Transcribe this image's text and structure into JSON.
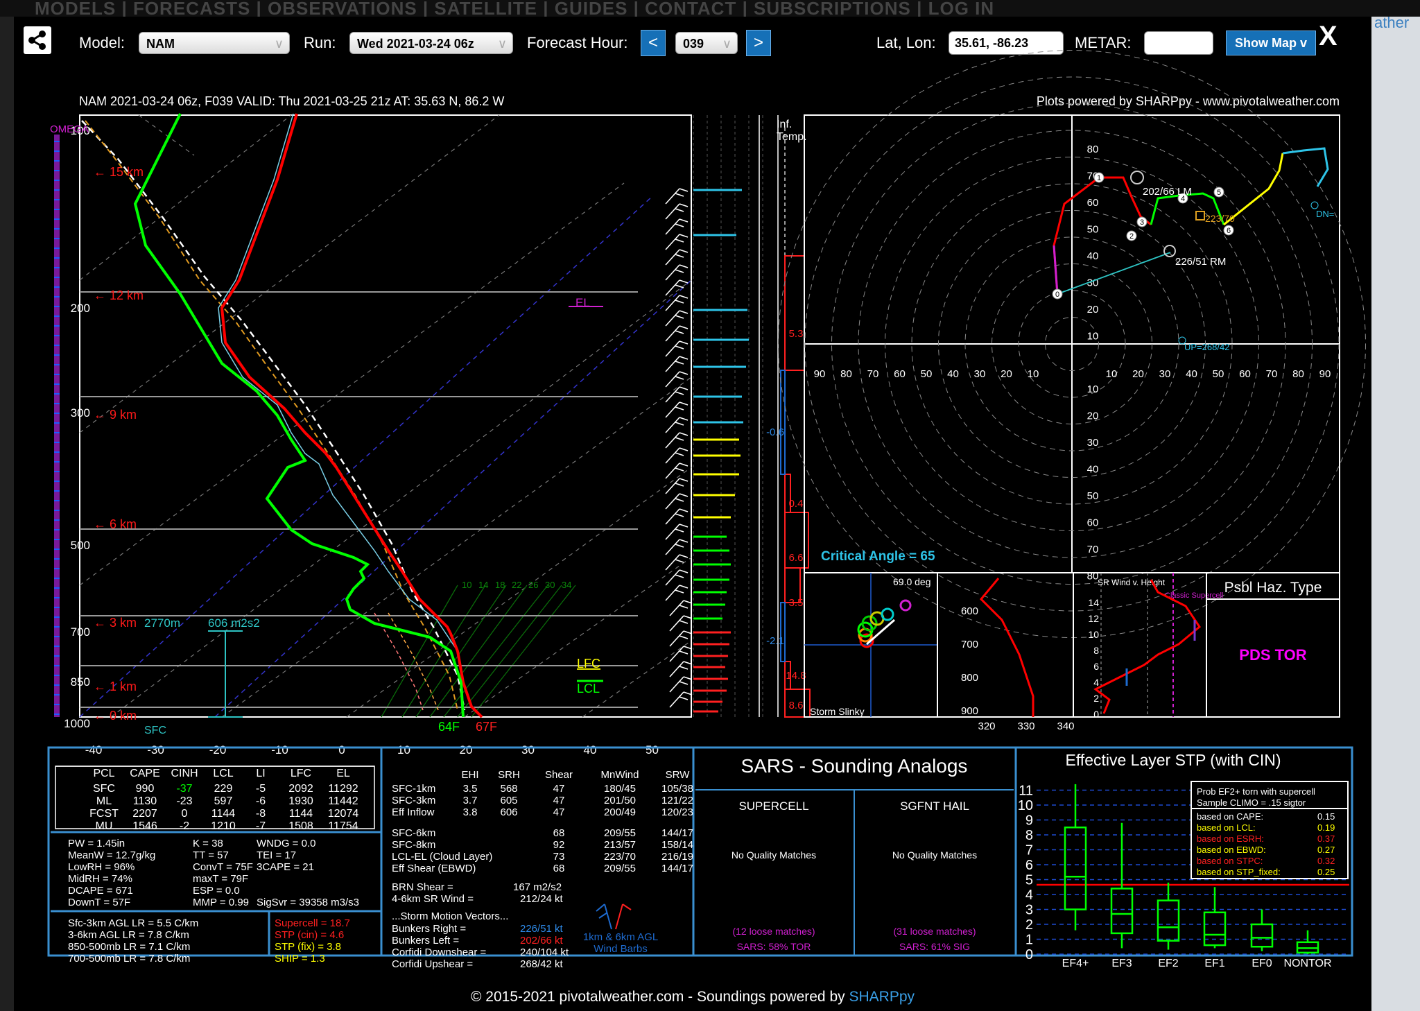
{
  "background": {
    "nav_text": "MODELS | FORECASTS | OBSERVATIONS | SATELLITE | GUIDES | CONTACT | SUBSCRIPTIONS | LOG IN",
    "right_word": "ather"
  },
  "toolbar": {
    "model_label": "Model:",
    "model_value": "NAM",
    "run_label": "Run:",
    "run_value": "Wed 2021-03-24 06z",
    "fhour_label": "Forecast Hour:",
    "fhour_prev": "<",
    "fhour_value": "039",
    "fhour_next": ">",
    "latlon_label": "Lat, Lon:",
    "latlon_value": "35.61, -86.23",
    "metar_label": "METAR:",
    "metar_value": "",
    "show_map": "Show Map v",
    "close": "X"
  },
  "header": {
    "left": "NAM 2021-03-24 06z, F039  VALID: Thu 2021-03-25 21z  AT: 35.63 N, 86.2 W",
    "right": "Plots powered by SHARPpy - www.pivotalweather.com"
  },
  "skewt": {
    "pressure_labels": [
      "100",
      "200",
      "300",
      "500",
      "700",
      "850",
      "1000"
    ],
    "height_labels": [
      "15 km",
      "12 km",
      "9 km",
      "6 km",
      "3 km",
      "1 km",
      "0 km"
    ],
    "temp_ticks": [
      "-40",
      "-30",
      "-20",
      "-10",
      "0",
      "10",
      "20",
      "30",
      "40",
      "50"
    ],
    "omega": "OMEGA",
    "el": "EL",
    "lfc": "LFC",
    "lcl": "LCL",
    "eff_inflow_height": "2770m",
    "eff_inflow_srh": "606 m2s2",
    "sfc": "SFC",
    "sfc_td": "64F",
    "sfc_t": "67F",
    "mix_ratios": [
      "10",
      "14",
      "18",
      "22",
      "26",
      "30",
      "34"
    ]
  },
  "inftemp": {
    "title": [
      "Inf.",
      "Temp."
    ],
    "values": [
      "5.3",
      "-0.6",
      "0.4",
      "6.6",
      "3.5",
      "-2.1",
      "14.8",
      "8.6"
    ]
  },
  "hodograph": {
    "ring_labels": [
      "80",
      "70",
      "60",
      "50",
      "40",
      "30",
      "20",
      "10"
    ],
    "axis_labels": [
      "90",
      "80",
      "70",
      "60",
      "50",
      "40",
      "30",
      "20",
      "10"
    ],
    "points": [
      "0",
      "1",
      "2",
      "3",
      "4",
      "5",
      "6"
    ],
    "lm": "202/66 LM",
    "rm": "226/51 RM",
    "mean": "223/70",
    "dn": "DN=",
    "up": "UP=268/42",
    "critical_angle": "Critical Angle = 65"
  },
  "storm_slinky": {
    "label": "Storm Slinky",
    "angle": "69.0 deg"
  },
  "theta_panel": {
    "p_labels": [
      "600",
      "700",
      "800",
      "900"
    ],
    "x_labels": [
      "320",
      "330",
      "340"
    ]
  },
  "srwind": {
    "title": "SR Wind v. Height",
    "classic": "Classic Supercell",
    "heights": [
      "14",
      "12",
      "10",
      "8",
      "6",
      "4",
      "2",
      "0"
    ]
  },
  "hazard": {
    "title": "Psbl Haz. Type",
    "value": "PDS TOR"
  },
  "parcels": {
    "headers": [
      "PCL",
      "CAPE",
      "CINH",
      "LCL",
      "LI",
      "LFC",
      "EL"
    ],
    "rows": [
      [
        "SFC",
        "990",
        "-37",
        "229",
        "-5",
        "2092",
        "11292"
      ],
      [
        "ML",
        "1130",
        "-23",
        "597",
        "-6",
        "1930",
        "11442"
      ],
      [
        "FCST",
        "2207",
        "0",
        "1144",
        "-8",
        "1144",
        "12074"
      ],
      [
        "MU",
        "1546",
        "-2",
        "1210",
        "-7",
        "1508",
        "11754"
      ]
    ],
    "indices": [
      [
        "PW = 1.45in",
        "K = 38",
        "WNDG = 0.0"
      ],
      [
        "MeanW = 12.7g/kg",
        "TT = 57",
        "TEI = 17"
      ],
      [
        "LowRH = 96%",
        "ConvT = 75F",
        "3CAPE = 21"
      ],
      [
        "MidRH = 74%",
        "maxT = 79F",
        ""
      ],
      [
        "DCAPE = 671",
        "ESP = 0.0",
        ""
      ],
      [
        "DownT = 57F",
        "MMP = 0.99",
        "SigSvr = 39358 m3/s3"
      ]
    ],
    "lapse": [
      "Sfc-3km AGL LR = 5.5 C/km",
      "3-6km AGL LR = 7.8 C/km",
      "850-500mb LR = 7.1 C/km",
      "700-500mb LR = 7.8 C/km"
    ],
    "composite": [
      "Supercell = 18.7",
      "STP (cin) = 4.6",
      "STP (fix) = 3.8",
      "SHIP = 1.3"
    ]
  },
  "kinematics": {
    "headers": [
      "EHI",
      "SRH",
      "Shear",
      "MnWind",
      "SRW"
    ],
    "rows": [
      [
        "SFC-1km",
        "3.5",
        "568",
        "47",
        "180/45",
        "105/38"
      ],
      [
        "SFC-3km",
        "3.7",
        "605",
        "47",
        "201/50",
        "121/22"
      ],
      [
        "Eff Inflow",
        "3.8",
        "606",
        "47",
        "200/49",
        "120/23"
      ],
      [
        "SFC-6km",
        "",
        "",
        "68",
        "209/55",
        "144/17"
      ],
      [
        "SFC-8km",
        "",
        "",
        "92",
        "213/57",
        "158/14"
      ],
      [
        "LCL-EL (Cloud Layer)",
        "",
        "",
        "73",
        "223/70",
        "216/19"
      ],
      [
        "Eff Shear (EBWD)",
        "",
        "",
        "68",
        "209/55",
        "144/17"
      ]
    ],
    "brn": "BRN Shear =",
    "brn_val": "167 m2/s2",
    "sr46": "4-6km SR Wind =",
    "sr46_val": "212/24 kt",
    "motion_title": "...Storm Motion Vectors...",
    "motions": [
      [
        "Bunkers Right =",
        "226/51 kt"
      ],
      [
        "Bunkers Left =",
        "202/66 kt"
      ],
      [
        "Corfidi Downshear =",
        "240/104 kt"
      ],
      [
        "Corfidi Upshear =",
        "268/42 kt"
      ]
    ],
    "barbs_label": [
      "1km & 6km AGL",
      "Wind Barbs"
    ]
  },
  "sars": {
    "title": "SARS - Sounding Analogs",
    "supercell": "SUPERCELL",
    "hail": "SGFNT HAIL",
    "no_match": "No Quality Matches",
    "sc_loose": "(12 loose matches)",
    "sc_pct": "SARS: 58% TOR",
    "hail_loose": "(31 loose matches)",
    "hail_pct": "SARS: 61% SIG"
  },
  "stp": {
    "title": "Effective Layer STP (with CIN)",
    "y_labels": [
      "11",
      "10",
      "9",
      "8",
      "7",
      "6",
      "5",
      "4",
      "3",
      "2",
      "1",
      "0"
    ],
    "categories": [
      "EF4+",
      "EF3",
      "EF2",
      "EF1",
      "EF0",
      "NONTOR"
    ],
    "prob_title": [
      "Prob EF2+ torn with supercell",
      "Sample CLIMO = .15 sigtor"
    ],
    "prob_rows": [
      [
        "based on CAPE:",
        "0.15"
      ],
      [
        "based on LCL:",
        "0.19"
      ],
      [
        "based on ESRH:",
        "0.37"
      ],
      [
        "based on EBWD:",
        "0.27"
      ],
      [
        "based on STPC:",
        "0.32"
      ],
      [
        "based on STP_fixed:",
        "0.25"
      ]
    ]
  },
  "footer": {
    "text": "© 2015-2021 pivotalweather.com - Soundings powered by ",
    "link": "SHARPpy"
  },
  "colors": {
    "temp": "#ff0000",
    "dewpoint": "#00ff00",
    "panel_border": "#3a8fd0",
    "button": "#1670b7",
    "hazard": "#ff00ff"
  }
}
